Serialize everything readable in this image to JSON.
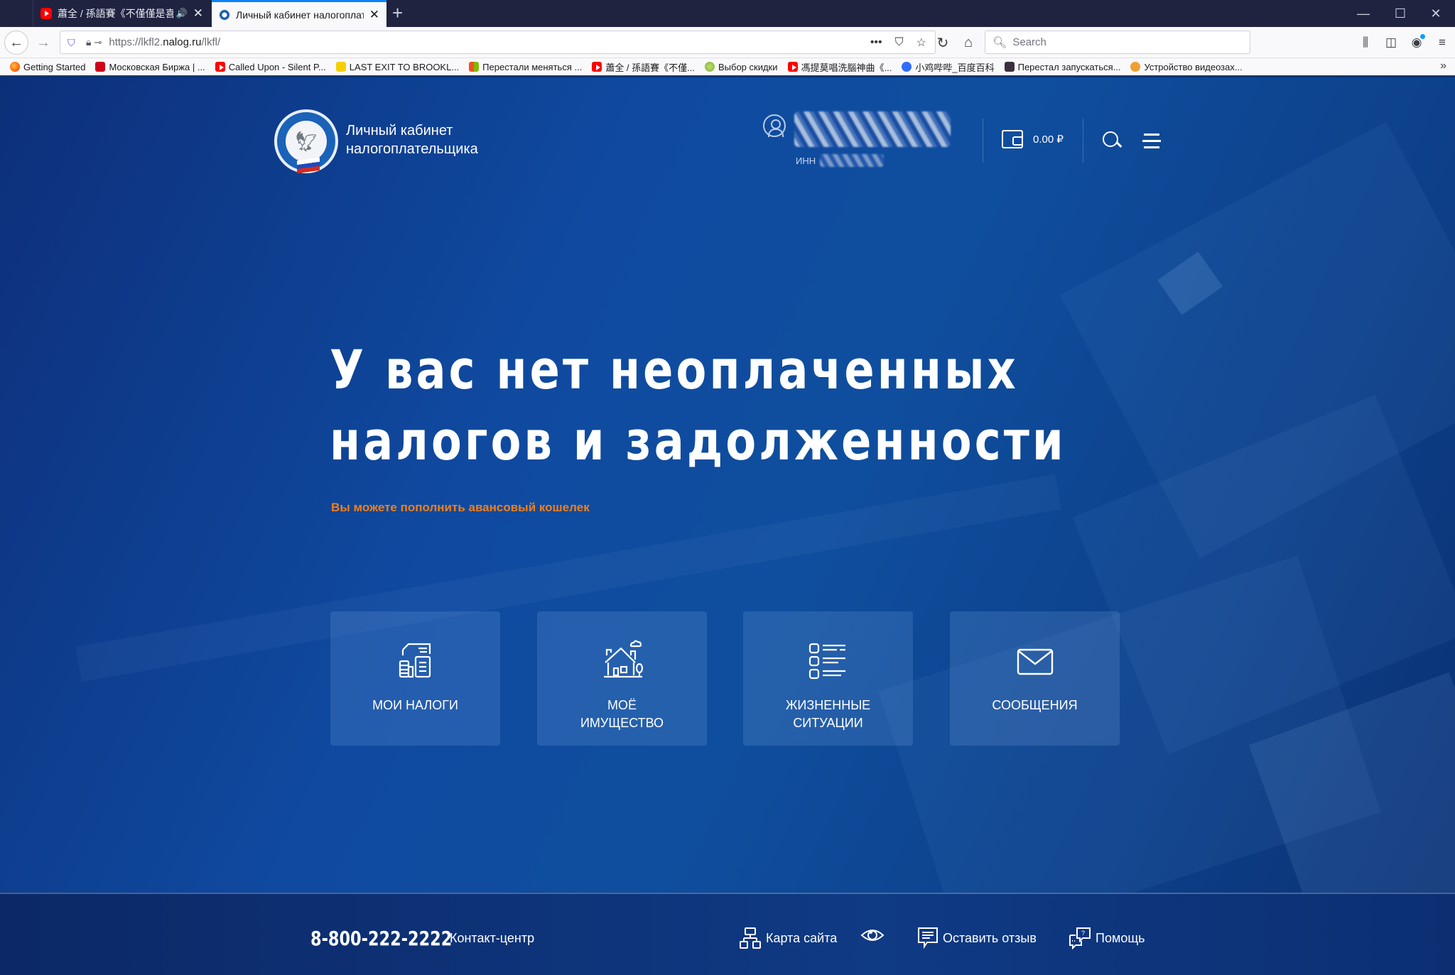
{
  "browser": {
    "tabs": [
      {
        "title": "蕭全 / 孫語賽《不僅僅是喜歡》",
        "favicon": "youtube-icon",
        "audio": true,
        "active": false
      },
      {
        "title": "Личный кабинет налогоплательщика",
        "favicon": "fns-logo-icon",
        "audio": false,
        "active": true
      }
    ],
    "new_tab_label": "+",
    "url": {
      "prefix": "https://lkfl2.",
      "host": "nalog.ru",
      "path": "/lkfl/"
    },
    "search_placeholder": "Search",
    "bookmarks": [
      {
        "label": "Getting Started",
        "icon": "firefox-icon"
      },
      {
        "label": "Московская Биржа | ...",
        "icon": "moex-icon"
      },
      {
        "label": "Called Upon - Silent P...",
        "icon": "youtube-icon"
      },
      {
        "label": "LAST EXIT TO BROOKL...",
        "icon": "star-icon"
      },
      {
        "label": "Перестали меняться ...",
        "icon": "microsoft-icon"
      },
      {
        "label": "蕭全 / 孫語賽《不僅...",
        "icon": "youtube-icon"
      },
      {
        "label": "Выбор скидки",
        "icon": "green-circle-icon"
      },
      {
        "label": "馮提莫唱洗腦神曲《...",
        "icon": "youtube-icon"
      },
      {
        "label": "小鸡哔哔_百度百科",
        "icon": "baidu-paw-icon"
      },
      {
        "label": "Перестал запускаться...",
        "icon": "site-icon"
      },
      {
        "label": "Устройство видеозах...",
        "icon": "cat-icon"
      }
    ]
  },
  "site": {
    "brand_line1": "Личный кабинет",
    "brand_line2": "налогоплательщика",
    "user": {
      "inn_label": "ИНН"
    },
    "wallet_balance": "0.00 ₽",
    "headline_line1": "У вас нет неоплаченных",
    "headline_line2": "налогов и задолженности",
    "subline": "Вы можете пополнить авансовый кошелек",
    "tiles": [
      {
        "label_line1": "Мои налоги",
        "label_line2": "",
        "icon": "taxes-icon"
      },
      {
        "label_line1": "Моё",
        "label_line2": "имущество",
        "icon": "property-house-icon"
      },
      {
        "label_line1": "Жизненные",
        "label_line2": "ситуации",
        "icon": "checklist-icon"
      },
      {
        "label_line1": "Сообщения",
        "label_line2": "",
        "icon": "envelope-icon"
      }
    ],
    "footer": {
      "phone": "8-800-222-2222",
      "contact_label": "Контакт-центр",
      "sitemap": "Карта сайта",
      "feedback": "Оставить отзыв",
      "help": "Помощь"
    },
    "colors": {
      "accent_orange": "#f07f1a",
      "background_blue": "#0f4aa0"
    }
  }
}
